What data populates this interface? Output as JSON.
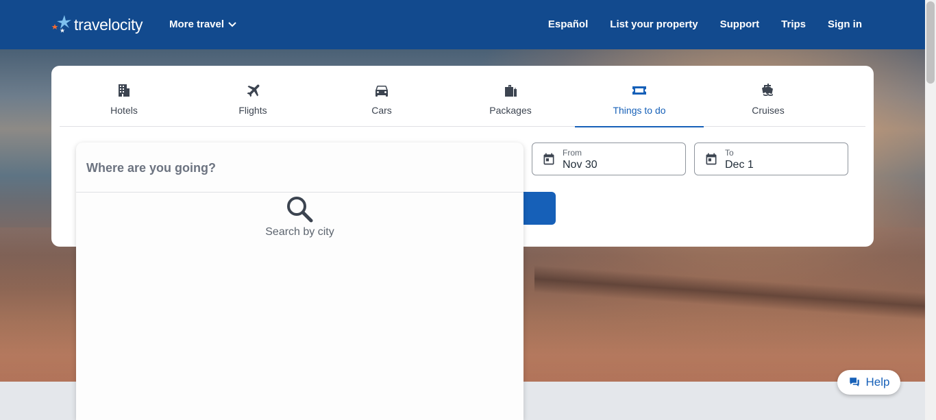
{
  "header": {
    "logo_text": "travelocity",
    "more_travel": "More travel",
    "nav": [
      "Español",
      "List your property",
      "Support",
      "Trips",
      "Sign in"
    ]
  },
  "tabs": [
    {
      "label": "Hotels",
      "icon": "building-icon"
    },
    {
      "label": "Flights",
      "icon": "plane-icon"
    },
    {
      "label": "Cars",
      "icon": "car-icon"
    },
    {
      "label": "Packages",
      "icon": "luggage-icon"
    },
    {
      "label": "Things to do",
      "icon": "ticket-icon",
      "active": true
    },
    {
      "label": "Cruises",
      "icon": "ship-icon"
    }
  ],
  "dates": {
    "from_caption": "From",
    "from_value": "Nov 30",
    "to_caption": "To",
    "to_value": "Dec 1"
  },
  "destination": {
    "placeholder": "Where are you going?",
    "hint": "Search by city"
  },
  "help": {
    "label": "Help"
  },
  "colors": {
    "brand": "#124a8e",
    "accent": "#1660b8"
  }
}
